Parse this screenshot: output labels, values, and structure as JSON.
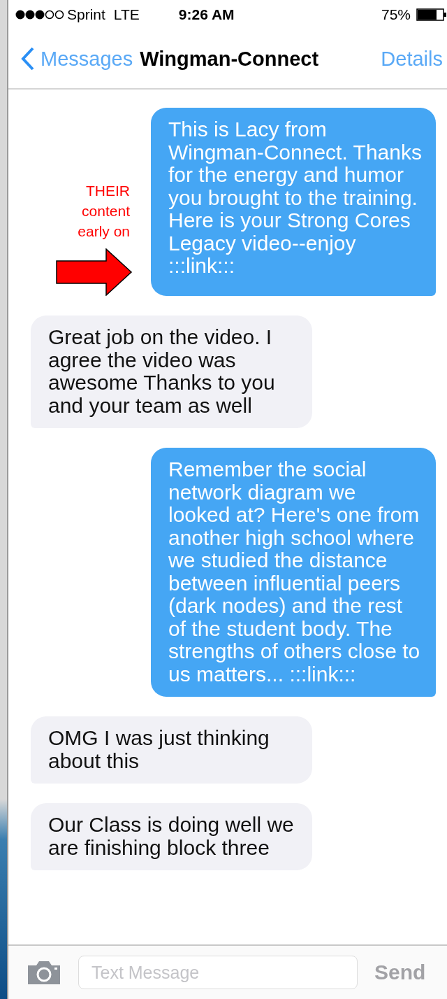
{
  "status_bar": {
    "carrier": "Sprint",
    "network": "LTE",
    "time": "9:26 AM",
    "battery": "75%"
  },
  "nav": {
    "back": "Messages",
    "title": "Wingman-Connect",
    "action": "Details"
  },
  "annotation": {
    "text": "THEIR content early on"
  },
  "messages": [
    {
      "kind": "sent",
      "text": "This is Lacy from Wingman-Connect. Thanks for the energy and humor you brought to the training. Here is your Strong Cores Legacy video--enjoy :::link:::"
    },
    {
      "kind": "received",
      "text": "Great job on the video. I agree the video was awesome Thanks to you and your team as well"
    },
    {
      "kind": "sent",
      "text": "Remember the social network diagram we looked at? Here's one from another high school where we studied the distance between influential peers (dark nodes) and the rest of the student body. The strengths of others close to us matters... :::link:::"
    },
    {
      "kind": "received",
      "text": "OMG I was just thinking about this"
    },
    {
      "kind": "received",
      "text": "Our Class is doing well we are finishing block three"
    }
  ],
  "composer": {
    "placeholder": "Text Message",
    "send": "Send",
    "send_disabled": true
  }
}
